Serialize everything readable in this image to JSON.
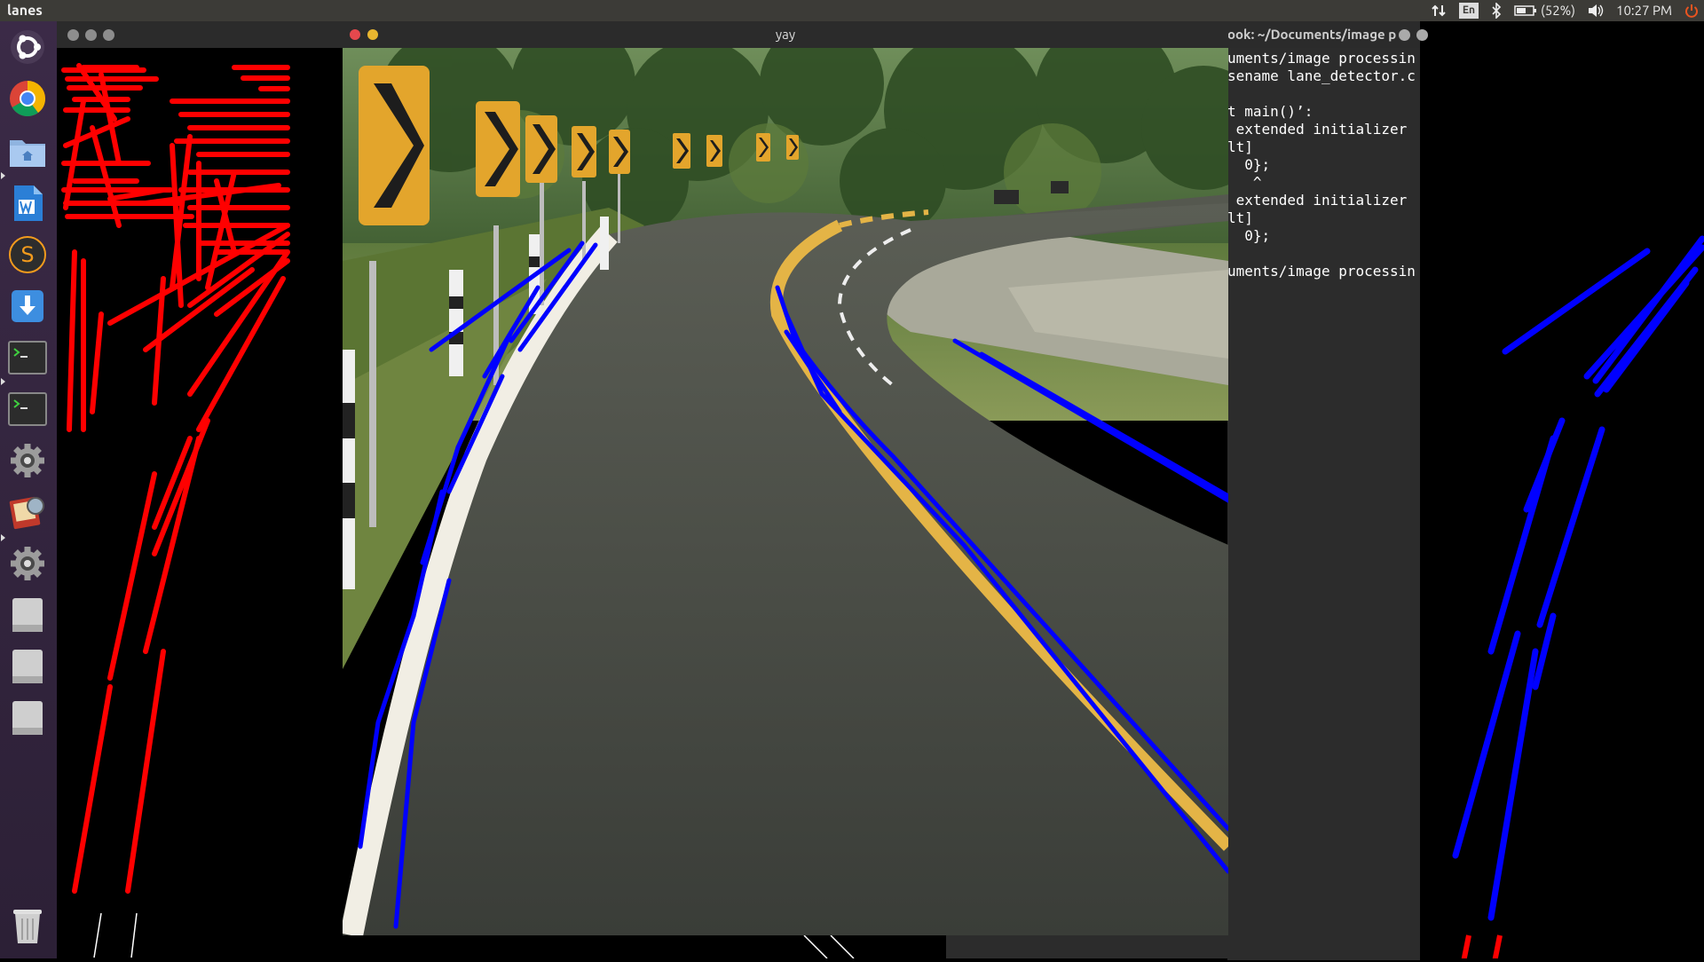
{
  "top_panel": {
    "app_title": "lanes",
    "keyboard": "En",
    "battery": "(52%)",
    "clock": "10:27 PM"
  },
  "launcher": {
    "items": [
      {
        "name": "ubuntu-dash-icon"
      },
      {
        "name": "chrome-icon"
      },
      {
        "name": "files-icon"
      },
      {
        "name": "writer-icon"
      },
      {
        "name": "sublime-icon"
      },
      {
        "name": "downloads-icon"
      },
      {
        "name": "terminal-icon"
      },
      {
        "name": "terminal-icon-2"
      },
      {
        "name": "settings-icon"
      },
      {
        "name": "image-viewer-icon"
      },
      {
        "name": "settings-icon-2"
      },
      {
        "name": "drive-icon"
      },
      {
        "name": "drive-icon-2"
      },
      {
        "name": "drive-icon-3"
      },
      {
        "name": "trash-icon"
      }
    ]
  },
  "windows": {
    "yay": {
      "title": "yay"
    },
    "terminal": {
      "title": "ook: ~/Documents/image pro",
      "lines": [
        "uments/image processin",
        "sename lane_detector.c",
        "",
        "t main()’:",
        " extended initializer",
        "lt]",
        "  0};",
        "   ^",
        " extended initializer",
        "lt]",
        "  0};",
        "",
        "uments/image processin"
      ]
    }
  },
  "colors": {
    "panel": "#3c3b37",
    "launcher": "#2f2239",
    "lane_overlay": "#0000ff",
    "edge_overlay": "#ff0000"
  }
}
